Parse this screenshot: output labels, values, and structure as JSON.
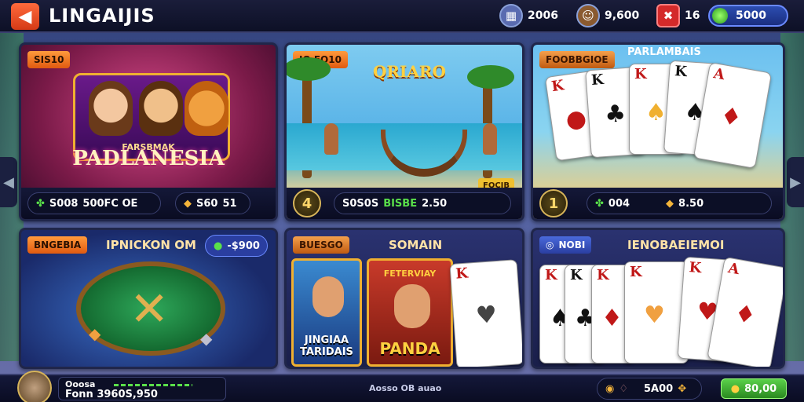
{
  "header": {
    "title": "LINGAIJIS",
    "back_icon": "chevron-left-icon",
    "stat_1": "2006",
    "stat_2": "9,600",
    "stat_3": "16",
    "coins": "5000"
  },
  "panels": {
    "p1": {
      "tag": "SIS10",
      "logo_small": "FARSBMAK",
      "logo": "PADLANESIA",
      "stat_left": "S008",
      "stat_right": "500FC OE",
      "stat_3": "S60",
      "stat_4": "51"
    },
    "p2": {
      "tag": "IO FO10",
      "logo": "QRIARO",
      "sign": "FOCIB",
      "btn": "4",
      "stat_left": "S0S0S",
      "stat_mid": "BISBE",
      "stat_right": "2.50"
    },
    "p3": {
      "tag": "FOOBBGIOE",
      "title": "PARLAMBAIS",
      "btn": "1",
      "stat_left": "004",
      "stat_right": "8.50"
    },
    "p4": {
      "tag": "BNGEBIA",
      "title": "IPNICKON OM",
      "chip": "-$900"
    },
    "p5": {
      "tag": "BUESGO",
      "title": "SOMAIN",
      "poster_1": "JINGIAA TARIDAIS",
      "poster_2": "PANDA",
      "poster_2_top": "FETERVIAY"
    },
    "p6": {
      "tag": "NOBI",
      "title": "IENOBAEIEMOI"
    }
  },
  "footer": {
    "user_line_1": "Ooosa",
    "user_line_2": "Fonn 3960S,950",
    "center": "Aosso OB auao",
    "value": "5A00",
    "button": "80,00"
  },
  "colors": {
    "accent_orange": "#e05a10",
    "accent_blue": "#2a3ea0",
    "accent_green": "#2a9a20",
    "gold": "#f0b030"
  }
}
